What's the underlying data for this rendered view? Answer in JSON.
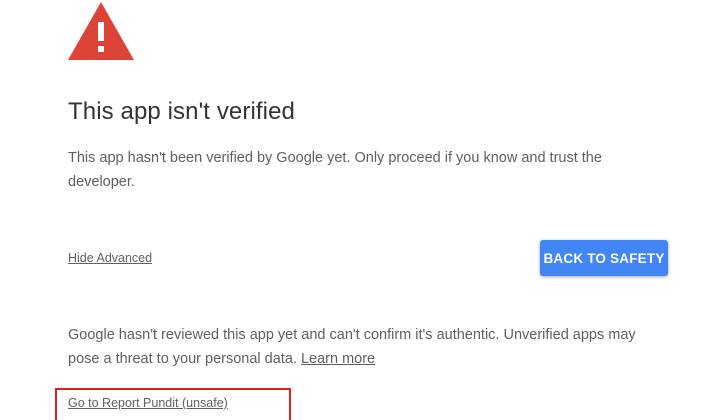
{
  "header": {
    "icon": "warning-triangle-icon",
    "icon_color": "#db4437"
  },
  "title": "This app isn't verified",
  "subtitle": "This app hasn't been verified by Google yet. Only proceed if you know and trust the developer.",
  "advanced_toggle_label": "Hide Advanced",
  "back_button_label": "BACK TO SAFETY",
  "details": {
    "text": "Google hasn't reviewed this app yet and can't confirm it's authentic. Unverified apps may pose a threat to your personal data.",
    "learn_more_label": "Learn more"
  },
  "proceed_link_label": "Go to Report Pundit (unsafe)",
  "colors": {
    "accent_button": "#4285f4",
    "highlight_border": "#e02020"
  }
}
